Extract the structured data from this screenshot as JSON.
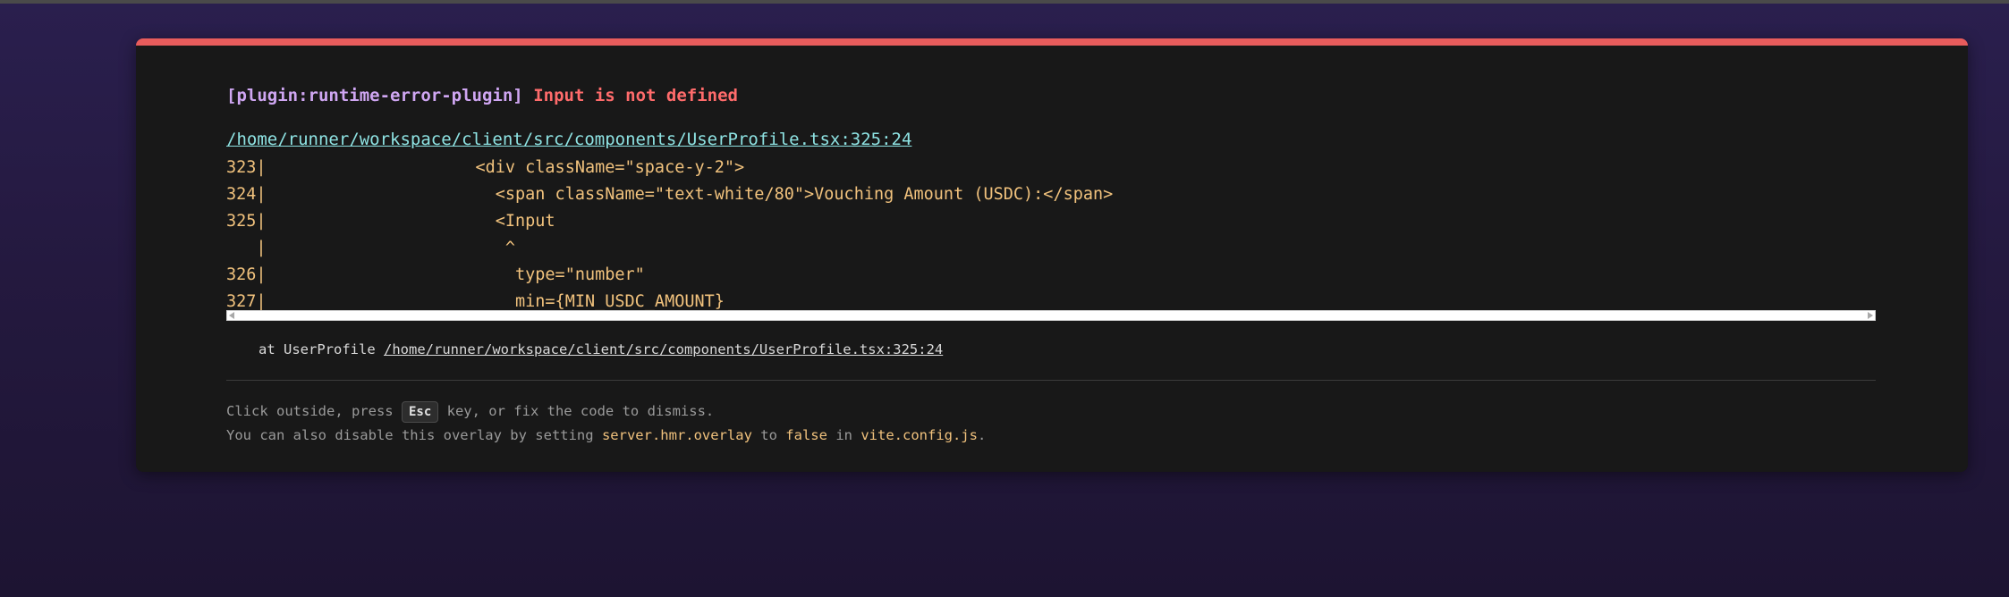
{
  "error": {
    "plugin": "[plugin:runtime-error-plugin]",
    "message": "Input is not defined",
    "file": "/home/runner/workspace/client/src/components/UserProfile.tsx:325:24"
  },
  "code_frame": [
    "323|                     <div className=\"space-y-2\">",
    "324|                       <span className=\"text-white/80\">Vouching Amount (USDC):</span>",
    "325|                       <Input",
    "   |                        ^",
    "326|                         type=\"number\"",
    "327|                         min={MIN_USDC_AMOUNT}"
  ],
  "stack": {
    "prefix": "at UserProfile",
    "link": "/home/runner/workspace/client/src/components/UserProfile.tsx:325:24"
  },
  "tip": {
    "line1_before": "Click outside, press",
    "key": "Esc",
    "line1_after": "key, or fix the code to dismiss.",
    "line2_a": "You can also disable this overlay by setting",
    "line2_setting": "server.hmr.overlay",
    "line2_b": "to",
    "line2_value": "false",
    "line2_c": "in",
    "line2_file": "vite.config.js",
    "line2_end": "."
  },
  "colors": {
    "accent_border": "#e85c5c",
    "plugin": "#cfa6f2",
    "error": "#ff6b6b",
    "link": "#8ee3e3",
    "code": "#f1c27d"
  }
}
